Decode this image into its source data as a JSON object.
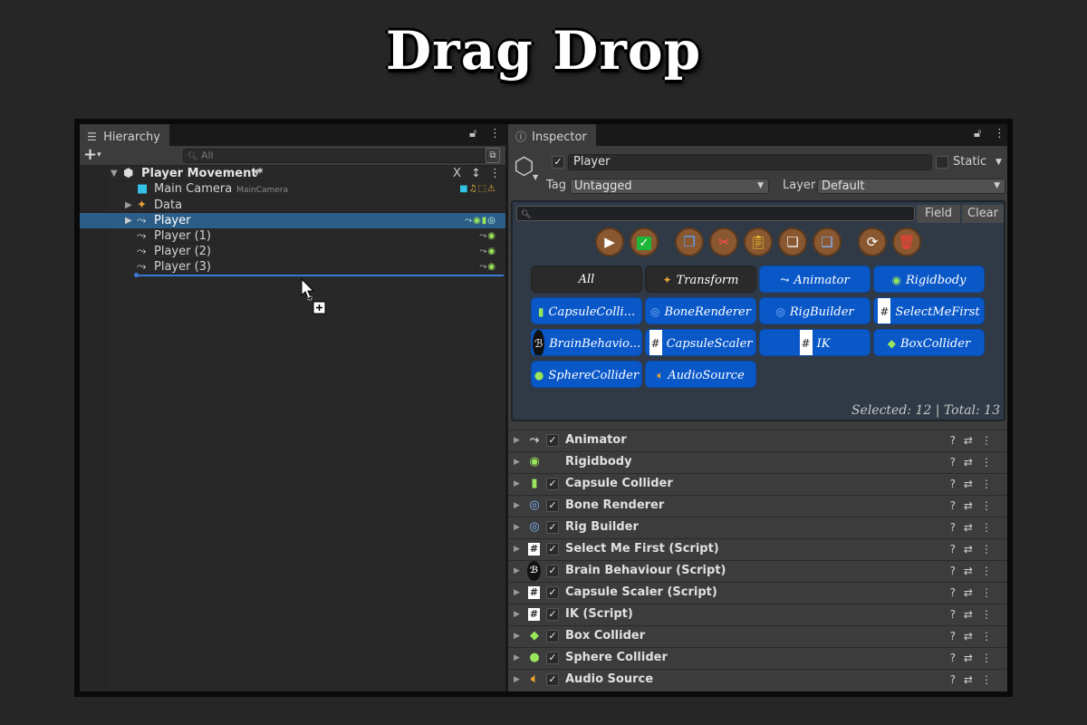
{
  "title": "Drag Drop",
  "hierarchy": {
    "tab_label": "Hierarchy",
    "search_placeholder": "All",
    "scene_name": "Player Movement*",
    "items": [
      {
        "label": "Main Camera",
        "tag": "MainCamera"
      },
      {
        "label": "Data"
      },
      {
        "label": "Player"
      },
      {
        "label": "Player (1)"
      },
      {
        "label": "Player (2)"
      },
      {
        "label": "Player (3)"
      }
    ]
  },
  "inspector": {
    "tab_label": "Inspector",
    "object_name": "Player",
    "static_label": "Static",
    "tag_label": "Tag",
    "tag_value": "Untagged",
    "layer_label": "Layer",
    "layer_value": "Default",
    "field_button": "Field",
    "clear_button": "Clear",
    "chips": [
      "All",
      "Transform",
      "Animator",
      "Rigidbody",
      "CapsuleColli...",
      "BoneRenderer",
      "RigBuilder",
      "SelectMeFirst",
      "BrainBehavio...",
      "CapsuleScaler",
      "IK",
      "BoxCollider",
      "SphereCollider",
      "AudioSource"
    ],
    "selected_info": "Selected: 12 | Total: 13",
    "components": [
      "Animator",
      "Rigidbody",
      "Capsule Collider",
      "Bone Renderer",
      "Rig Builder",
      "Select Me First (Script)",
      "Brain Behaviour (Script)",
      "Capsule Scaler (Script)",
      "IK (Script)",
      "Box Collider",
      "Sphere Collider",
      "Audio Source"
    ]
  },
  "colors": {
    "accent_blue": "#0a58c8",
    "selection": "#2c5d87",
    "drop_indicator": "#3a79d8",
    "action_button": "#8a5830"
  }
}
